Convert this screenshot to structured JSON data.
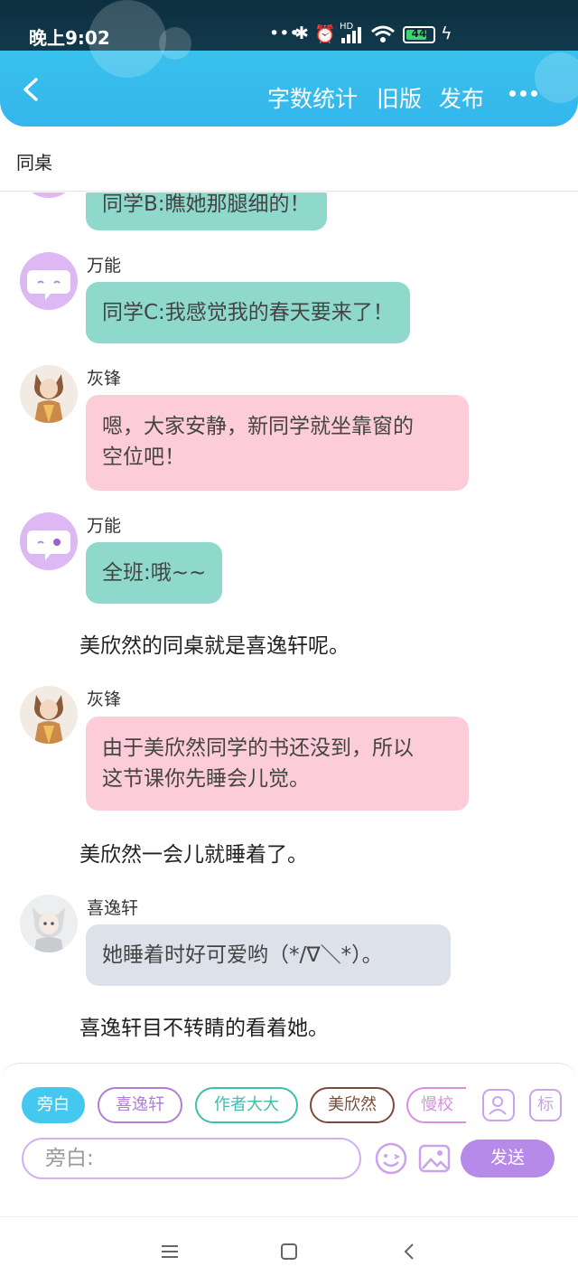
{
  "status": {
    "time": "晚上9:02",
    "battery": "44",
    "signal_label": "HD"
  },
  "header": {
    "actions": [
      "字数统计",
      "旧版",
      "发布"
    ]
  },
  "chapter": {
    "title": "同桌"
  },
  "messages": [
    {
      "type": "bubble",
      "speaker": "",
      "text": "同学B:瞧她那腿细的！",
      "color": "green"
    },
    {
      "type": "bubble",
      "speaker": "万能",
      "text": "同学C:我感觉我的春天要来了！",
      "color": "green"
    },
    {
      "type": "bubble",
      "speaker": "灰锋",
      "lines": [
        "嗯，大家安静，新同学就坐靠窗的",
        "空位吧！"
      ],
      "color": "pink"
    },
    {
      "type": "bubble",
      "speaker": "万能",
      "text": "全班:哦~~",
      "color": "green"
    },
    {
      "type": "narration",
      "text": "美欣然的同桌就是喜逸轩呢。"
    },
    {
      "type": "bubble",
      "speaker": "灰锋",
      "lines": [
        "由于美欣然同学的书还没到，所以",
        "这节课你先睡会儿觉。"
      ],
      "color": "pink"
    },
    {
      "type": "narration",
      "text": "美欣然一会儿就睡着了。"
    },
    {
      "type": "bubble",
      "speaker": "喜逸轩",
      "text": "她睡着时好可爱哟（*/∇＼*）。",
      "color": "grey"
    },
    {
      "type": "narration",
      "text": "喜逸轩目不转睛的看着她。"
    }
  ],
  "roles": [
    {
      "label": "旁白",
      "active": true,
      "color": "#44c8ef"
    },
    {
      "label": "喜逸轩",
      "color": "#b07ed6"
    },
    {
      "label": "作者大大",
      "color": "#3dbfae"
    },
    {
      "label": "美欣然",
      "color": "#7a4b3a"
    },
    {
      "label": "慢校",
      "color": "#d88fe0"
    }
  ],
  "panel": {
    "mark_button": "标",
    "input_placeholder": "旁白:",
    "send_label": "发送"
  },
  "colors": {
    "accent": "#39c1ec",
    "send": "#b68ae8",
    "green_bubble": "#8ed9cb",
    "pink_bubble": "#fcccd9",
    "grey_bubble": "#dde2ea"
  }
}
